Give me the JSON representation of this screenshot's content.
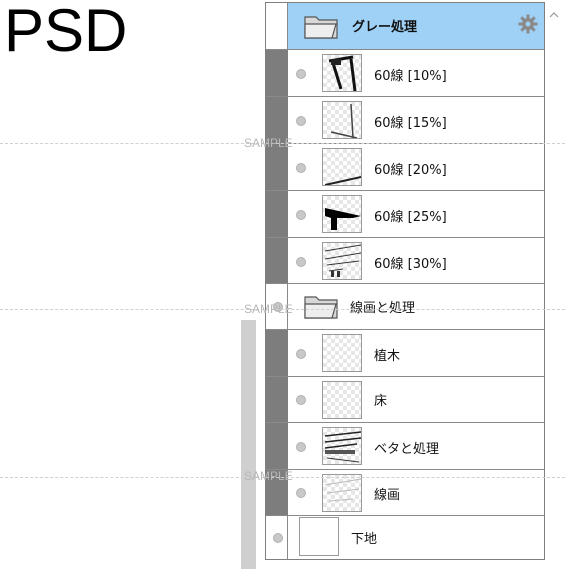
{
  "title": "PSD",
  "watermark": "SAMPLE",
  "layers_panel": {
    "group_header": {
      "name": "グレー処理",
      "icon": "folder-icon",
      "settings_icon": "gear-icon"
    },
    "layers": [
      {
        "name": "60線 [10%]",
        "thumb": "sketch-a"
      },
      {
        "name": "60線 [15%]",
        "thumb": "sketch-b"
      },
      {
        "name": "60線 [20%]",
        "thumb": "sketch-c"
      },
      {
        "name": "60線 [25%]",
        "thumb": "sketch-d"
      },
      {
        "name": "60線 [30%]",
        "thumb": "sketch-e"
      }
    ],
    "subgroup": {
      "name": "線画と処理",
      "icon": "folder-icon"
    },
    "sublayers": [
      {
        "name": "植木",
        "thumb": "blank"
      },
      {
        "name": "床",
        "thumb": "blank"
      },
      {
        "name": "ベタと処理",
        "thumb": "sketch-f"
      },
      {
        "name": "線画",
        "thumb": "sketch-g"
      }
    ],
    "base_layer": {
      "name": "下地",
      "thumb": "white"
    }
  },
  "colors": {
    "group_header_bg": "#9fd0f5",
    "indent_bar": "#7d7d7d"
  }
}
